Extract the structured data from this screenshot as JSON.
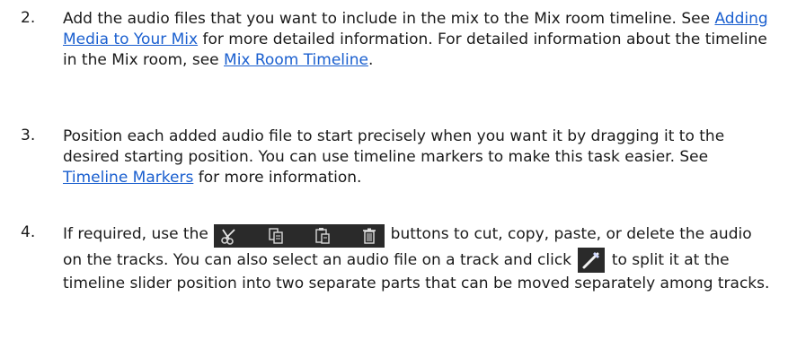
{
  "steps": [
    {
      "number": "2.",
      "p1": "Add the audio files that you want to include in the mix to the Mix room timeline. See ",
      "link1": "Adding Media to Your Mix",
      "p2": " for more detailed information. For detailed information about the timeline in the Mix room, see ",
      "link2": "Mix Room Timeline",
      "p3": "."
    },
    {
      "number": "3.",
      "p1": "Position each added audio file to start precisely when you want it by dragging it to the desired starting position. You can use timeline markers to make this task easier. See ",
      "link1": "Timeline Markers",
      "p2": " for more information."
    },
    {
      "number": "4.",
      "p1": "If required, use the ",
      "p2": " buttons to cut, copy, paste, or delete the audio on the tracks. You can also select an audio file on a track and click ",
      "p3": " to split it at the timeline slider position into two separate parts that can be moved separately among tracks."
    }
  ],
  "icons": [
    "scissors-icon",
    "copy-icon",
    "paste-icon",
    "trash-icon",
    "split-icon"
  ],
  "colors": {
    "link": "#1a5fcf",
    "toolbar_bg": "#2a2a2a",
    "text": "#1a1a1a"
  }
}
